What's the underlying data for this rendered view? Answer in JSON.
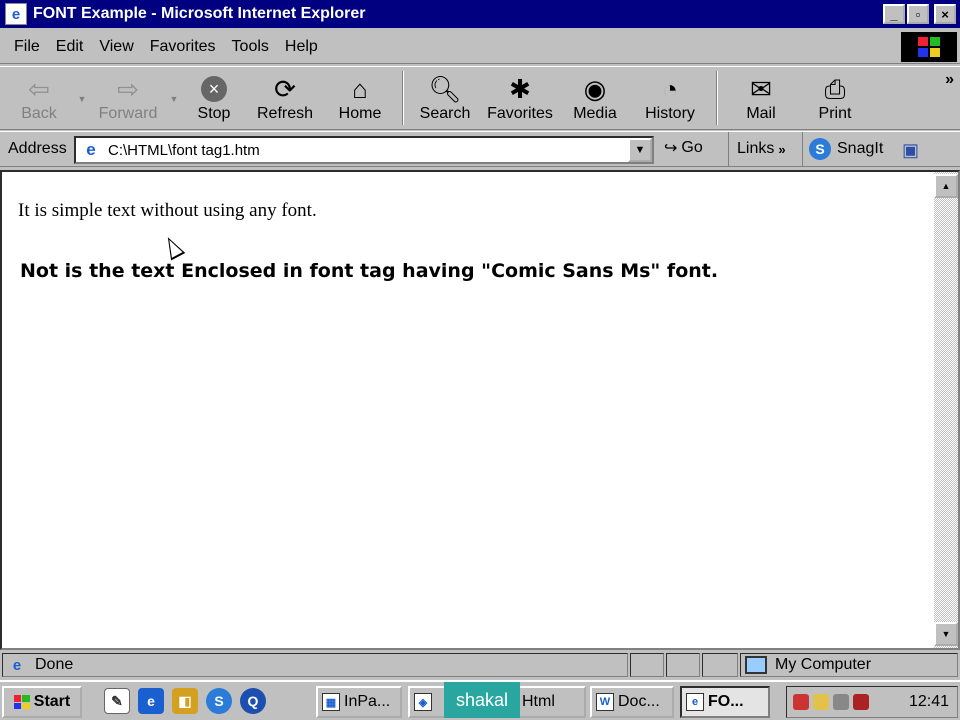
{
  "window": {
    "title": "FONT Example - Microsoft Internet Explorer",
    "controls": [
      "_",
      "▫",
      "×"
    ]
  },
  "menu": [
    "File",
    "Edit",
    "View",
    "Favorites",
    "Tools",
    "Help"
  ],
  "toolbar": {
    "back": "Back",
    "forward": "Forward",
    "stop": "Stop",
    "refresh": "Refresh",
    "home": "Home",
    "search": "Search",
    "favorites": "Favorites",
    "media": "Media",
    "history": "History",
    "mail": "Mail",
    "print": "Print",
    "more": "»"
  },
  "address": {
    "label": "Address",
    "url": "C:\\HTML\\font tag1.htm",
    "go": "Go",
    "links": "Links",
    "links_chevron": "»",
    "snagit": "SnagIt"
  },
  "page": {
    "line1": "It is simple text without using any font.",
    "line2": "Not is the text Enclosed in font tag having \"Comic Sans Ms\" font."
  },
  "status": {
    "text": "Done",
    "zone": "My Computer"
  },
  "taskbar": {
    "start": "Start",
    "tasks": [
      "InPa...",
      "",
      "Html",
      "Doc...",
      "FO..."
    ],
    "overlay": "shakal",
    "clock": "12:41"
  },
  "colors": {
    "title_bg": "#000080",
    "chrome": "#c0c0c0",
    "overlay": "#2aa6a0"
  }
}
